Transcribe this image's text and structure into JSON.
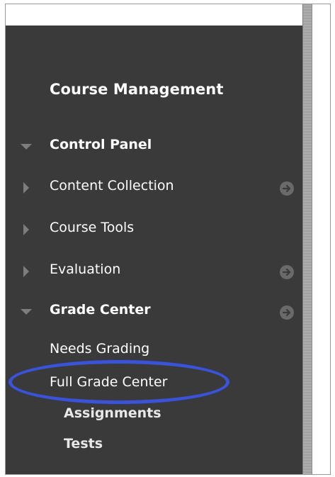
{
  "panel": {
    "section_title": "Course Management"
  },
  "menu": [
    {
      "label": "Control Panel",
      "expanded": true,
      "bold": true,
      "has_go_icon": false
    },
    {
      "label": "Content Collection",
      "expanded": false,
      "bold": false,
      "has_go_icon": true
    },
    {
      "label": "Course Tools",
      "expanded": false,
      "bold": false,
      "has_go_icon": false
    },
    {
      "label": "Evaluation",
      "expanded": false,
      "bold": false,
      "has_go_icon": true
    },
    {
      "label": "Grade Center",
      "expanded": true,
      "bold": true,
      "has_go_icon": true
    }
  ],
  "grade_center_items": [
    {
      "label": "Needs Grading"
    },
    {
      "label": "Full Grade Center",
      "highlighted": true
    },
    {
      "label": "Assignments"
    },
    {
      "label": "Tests"
    }
  ],
  "colors": {
    "sidebar_bg": "#3a3a3a",
    "highlight": "#3b53d6",
    "text": "#ffffff",
    "arrow": "#7d7d7d"
  },
  "icons": {
    "expanded_arrow": "triangle-down-icon",
    "collapsed_arrow": "triangle-right-icon",
    "go": "circle-arrow-right-icon"
  }
}
